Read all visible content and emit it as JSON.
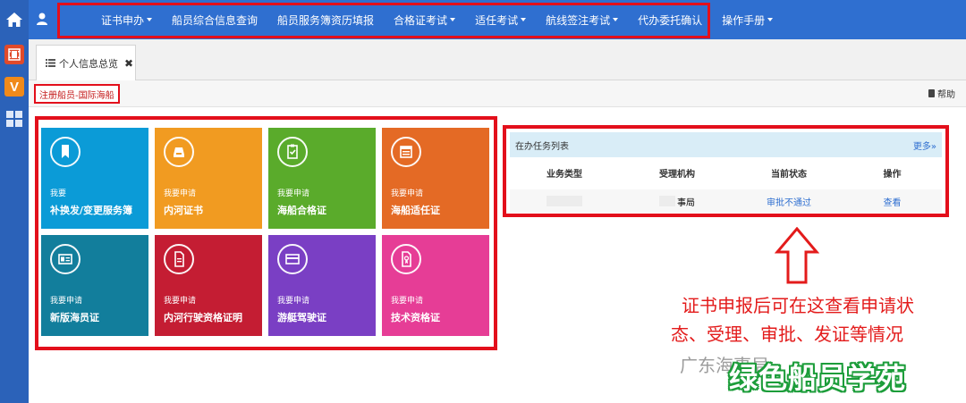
{
  "nav": {
    "items": [
      {
        "label": "证书申办",
        "dropdown": true
      },
      {
        "label": "船员综合信息查询",
        "dropdown": false
      },
      {
        "label": "船员服务簿资历填报",
        "dropdown": false
      },
      {
        "label": "合格证考试",
        "dropdown": true
      },
      {
        "label": "适任考试",
        "dropdown": true
      },
      {
        "label": "航线签注考试",
        "dropdown": true
      },
      {
        "label": "代办委托确认",
        "dropdown": false
      },
      {
        "label": "操作手册",
        "dropdown": true
      }
    ]
  },
  "tab": {
    "label": "个人信息总览",
    "close": "✖"
  },
  "breadcrumb": "注册船员-国际海船",
  "help_label": "帮助",
  "tiles": [
    {
      "line1": "我要",
      "line2": "补换发/变更服务簿",
      "color": "#0b9bd7",
      "icon": "bookmark-icon"
    },
    {
      "line1": "我要申请",
      "line2": "内河证书",
      "color": "#f19b21",
      "icon": "inbox-icon"
    },
    {
      "line1": "我要申请",
      "line2": "海船合格证",
      "color": "#5aab2b",
      "icon": "clipboard-check-icon"
    },
    {
      "line1": "我要申请",
      "line2": "海船适任证",
      "color": "#e46a25",
      "icon": "calendar-icon"
    },
    {
      "line1": "我要申请",
      "line2": "新版海员证",
      "color": "#127e9c",
      "icon": "id-card-icon"
    },
    {
      "line1": "我要申请",
      "line2": "内河行驶资格证明",
      "color": "#c41d33",
      "icon": "document-icon"
    },
    {
      "line1": "我要申请",
      "line2": "游艇驾驶证",
      "color": "#7a3fc4",
      "icon": "card-icon"
    },
    {
      "line1": "我要申请",
      "line2": "技术资格证",
      "color": "#e63d96",
      "icon": "certificate-icon"
    }
  ],
  "tasks": {
    "title": "在办任务列表",
    "more": "更多»",
    "columns": [
      "业务类型",
      "受理机构",
      "当前状态",
      "操作"
    ],
    "rows": [
      {
        "type": "",
        "agency": "事局",
        "status": "审批不通过",
        "action": "查看"
      }
    ]
  },
  "annotation": {
    "line1": "证书申报后可在这查看申请状",
    "line2": "态、受理、审批、发证等情况"
  },
  "watermark": {
    "gray": "广东海事局",
    "green": "绿色船员学苑"
  }
}
